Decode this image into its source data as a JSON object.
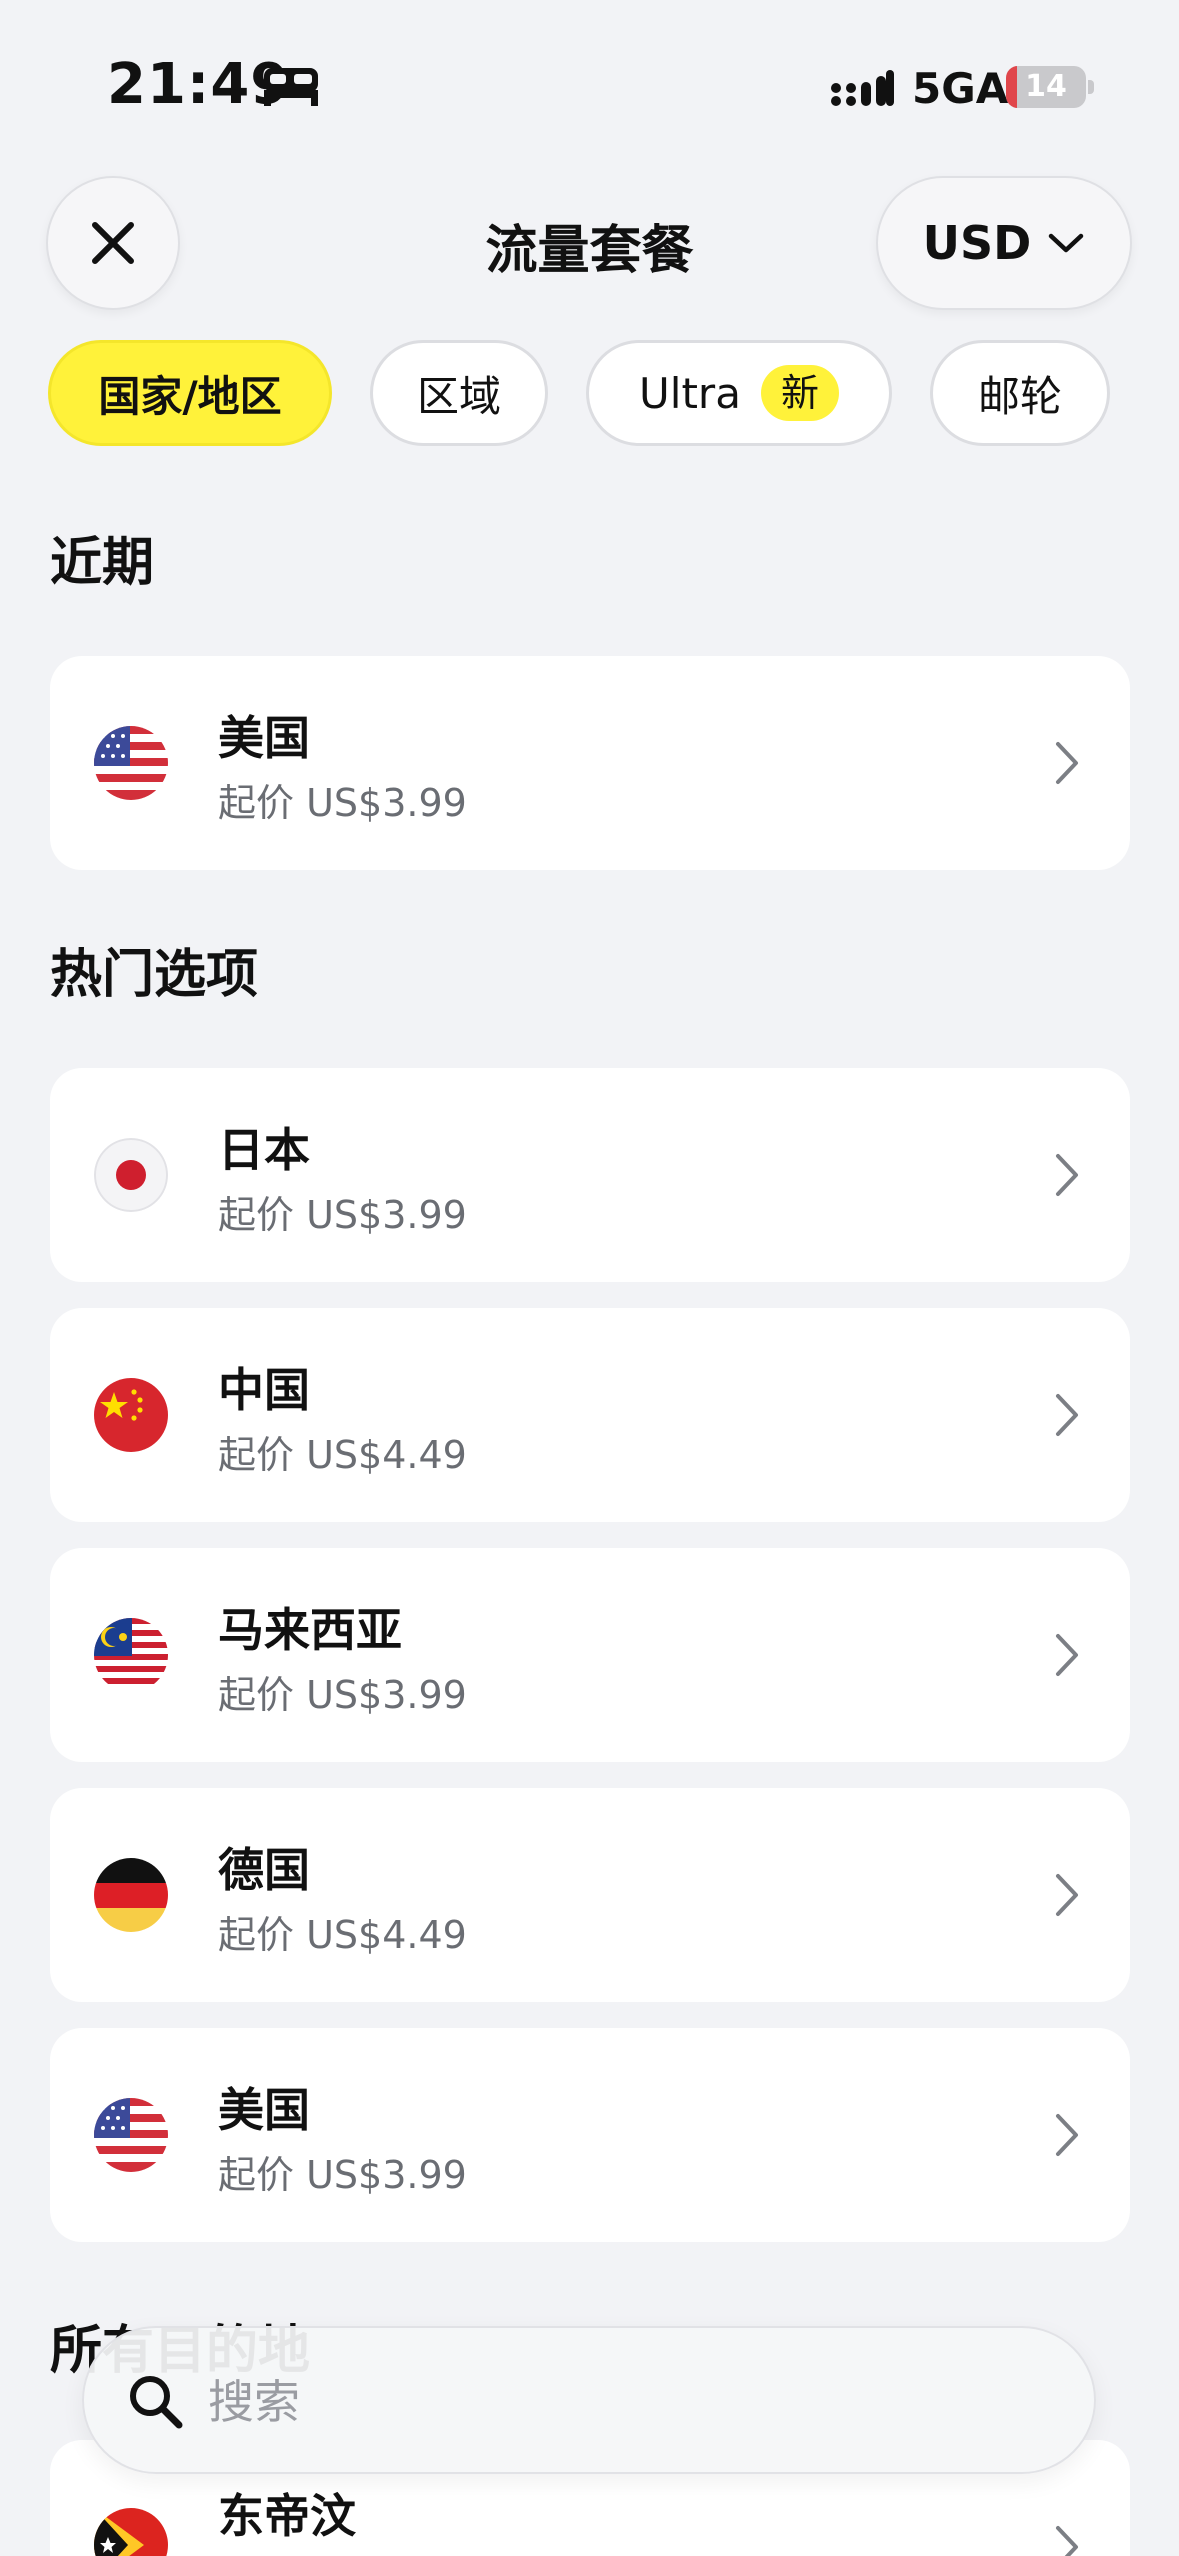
{
  "status_bar": {
    "time": "21:49",
    "network": "5GA",
    "battery": "14",
    "battery_level_percent": 14,
    "icons": [
      "bed-icon",
      "signal-icon",
      "battery-icon"
    ]
  },
  "header": {
    "title": "流量套餐",
    "currency": "USD",
    "close_icon": "close-icon",
    "currency_icon": "chevron-down-icon"
  },
  "tabs": [
    {
      "label": "国家/地区",
      "active": true
    },
    {
      "label": "区域",
      "active": false
    },
    {
      "label": "Ultra",
      "badge": "新",
      "active": false
    },
    {
      "label": "邮轮",
      "active": false
    }
  ],
  "sections": {
    "recent": {
      "title": "近期",
      "items": [
        {
          "name": "美国",
          "price": "起价 US$3.99",
          "flag": "us-flag-icon"
        }
      ]
    },
    "popular": {
      "title": "热门选项",
      "items": [
        {
          "name": "日本",
          "price": "起价 US$3.99",
          "flag": "japan-flag-icon"
        },
        {
          "name": "中国",
          "price": "起价 US$4.49",
          "flag": "china-flag-icon"
        },
        {
          "name": "马来西亚",
          "price": "起价 US$3.99",
          "flag": "malaysia-flag-icon"
        },
        {
          "name": "德国",
          "price": "起价 US$4.49",
          "flag": "germany-flag-icon"
        },
        {
          "name": "美国",
          "price": "起价 US$3.99",
          "flag": "us-flag-icon"
        }
      ]
    },
    "all": {
      "title": "所有目的地",
      "items": [
        {
          "name": "东帝汶",
          "flag": "timor-leste-flag-icon"
        }
      ]
    }
  },
  "search": {
    "placeholder": "搜索",
    "icon": "search-icon"
  },
  "colors": {
    "accent": "#fff23a",
    "background": "#f2f3f6",
    "card": "#ffffff",
    "secondary_text": "#6a6d73"
  }
}
